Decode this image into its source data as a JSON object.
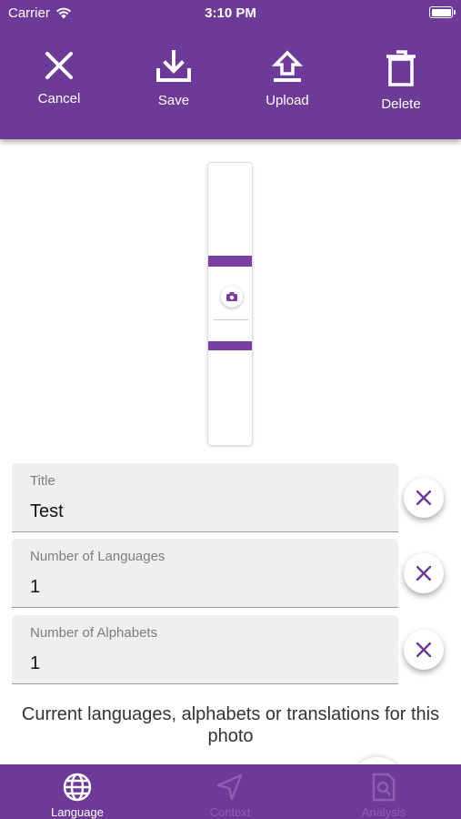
{
  "status_bar": {
    "carrier": "Carrier",
    "time": "3:10 PM"
  },
  "toolbar": {
    "cancel_label": "Cancel",
    "save_label": "Save",
    "upload_label": "Upload",
    "delete_label": "Delete"
  },
  "form": {
    "title": {
      "label": "Title",
      "value": "Test"
    },
    "num_languages": {
      "label": "Number of Languages",
      "value": "1"
    },
    "num_alphabets": {
      "label": "Number of Alphabets",
      "value": "1"
    }
  },
  "caption": "Current languages, alphabets or translations for this photo",
  "tabs": [
    {
      "label": "Language",
      "icon": "globe-icon",
      "active": true
    },
    {
      "label": "Context",
      "icon": "navigation-arrow-icon",
      "active": false
    },
    {
      "label": "Analysis",
      "icon": "document-search-icon",
      "active": false
    }
  ],
  "colors": {
    "primary": "#6e3a98",
    "field_bg": "#efeef0",
    "inactive_tab": "#8d5fae"
  }
}
